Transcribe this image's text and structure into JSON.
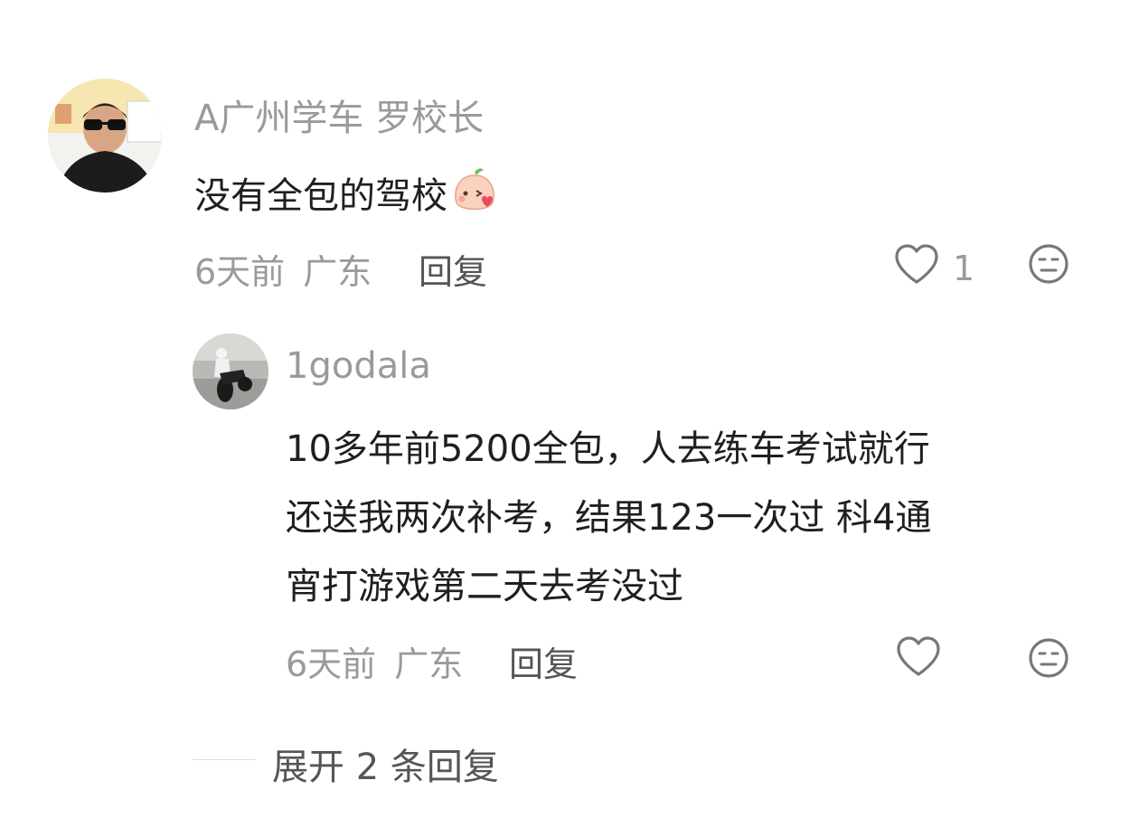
{
  "comment": {
    "author": "A广州学车 罗校长",
    "text": "没有全包的驾校",
    "emoji": "peach-kiss-emoji",
    "time": "6天前",
    "location": "广东",
    "reply_label": "回复",
    "like_count": "1"
  },
  "reply": {
    "author": "1godala",
    "lines": [
      "10多年前5200全包，人去练车考试就行",
      "还送我两次补考，结果123一次过 科4通",
      "宵打游戏第二天去考没过"
    ],
    "time": "6天前",
    "location": "广东",
    "reply_label": "回复"
  },
  "expand": {
    "label": "展开 2 条回复"
  },
  "colors": {
    "muted": "#9a9a9a",
    "text": "#1f1f1f",
    "action": "#555555"
  }
}
